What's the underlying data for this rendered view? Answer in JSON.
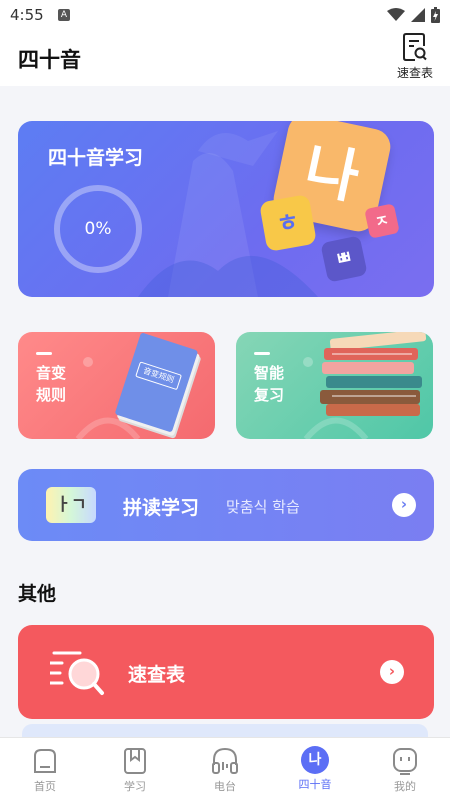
{
  "status_bar": {
    "time": "4:55",
    "indicator": "A"
  },
  "header": {
    "title": "四十音",
    "quick_ref_label": "速查表"
  },
  "main_card": {
    "title": "四十音学习",
    "progress": "0%",
    "tiles": [
      "나",
      "ㅎ",
      "ㅈ",
      "ㅃ"
    ]
  },
  "cards": {
    "sound_change": {
      "label": "音变\n规则",
      "book_label": "音变规则"
    },
    "smart_review": {
      "label": "智能\n复习"
    },
    "spelling": {
      "title": "拼读学习",
      "subtitle": "맞춤식 학습",
      "icon_text": "ㅏㄱ"
    }
  },
  "section": {
    "title": "其他"
  },
  "quick_card": {
    "title": "速查表"
  },
  "tabs": [
    {
      "label": "首页",
      "icon": "home-icon",
      "active": false
    },
    {
      "label": "学习",
      "icon": "bookmark-icon",
      "active": false
    },
    {
      "label": "电台",
      "icon": "headphones-icon",
      "active": false
    },
    {
      "label": "四十音",
      "icon": "forty-sounds-icon",
      "icon_text": "나",
      "active": true
    },
    {
      "label": "我的",
      "icon": "profile-icon",
      "active": false
    }
  ],
  "colors": {
    "accent": "#5b6ef5",
    "main_card": "#6377f3",
    "sound_change_card": "#f46a6f",
    "review_card": "#4fc7a7",
    "quick_card": "#f4595e"
  }
}
